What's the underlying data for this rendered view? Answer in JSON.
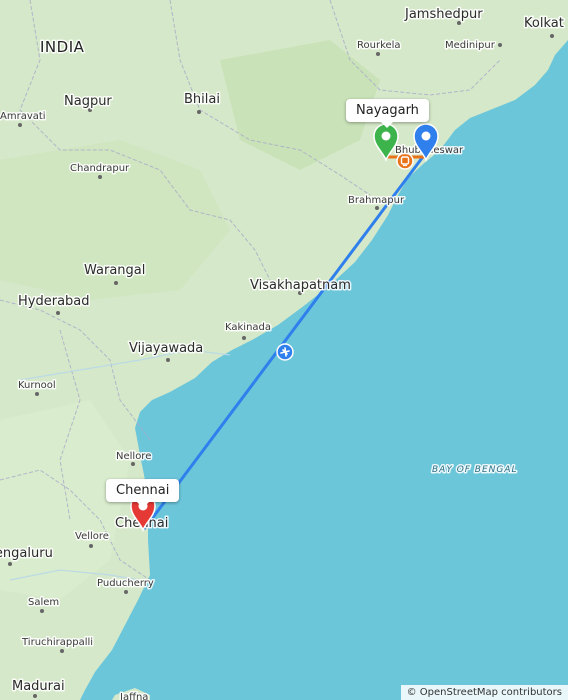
{
  "map": {
    "country_label": "INDIA",
    "water_label": "BAY OF BENGAL",
    "places": {
      "jamshedpur": "Jamshedpur",
      "kolkata": "Kolkat",
      "rourkela": "Rourkela",
      "medinipur": "Medinipur",
      "nagpur": "Nagpur",
      "bhilai": "Bhilai",
      "amravati": "Amravati",
      "chandrapur": "Chandrapur",
      "bhubaneswar": "Bhubaneswar",
      "brahmapur": "Brahmapur",
      "warangal": "Warangal",
      "hyderabad": "Hyderabad",
      "visakhapatnam": "Visakhapatnam",
      "kakinada": "Kakinada",
      "vijayawada": "Vijayawada",
      "kurnool": "Kurnool",
      "nellore": "Nellore",
      "chennai": "Chennai",
      "bengaluru": "Bengaluru",
      "vellore": "Vellore",
      "puducherry": "Puducherry",
      "salem": "Salem",
      "tiruchirappalli": "Tiruchirappalli",
      "madurai": "Madurai",
      "jaffna": "Jaffna"
    }
  },
  "markers": {
    "origin_callout": "Nayagarh",
    "destination_callout": "Chennai",
    "origin_color": "#3cb44b",
    "waypoint_color": "#2f80ed",
    "destination_color": "#e53935",
    "route_color": "#2f80ed"
  },
  "attribution": "© OpenStreetMap contributors"
}
